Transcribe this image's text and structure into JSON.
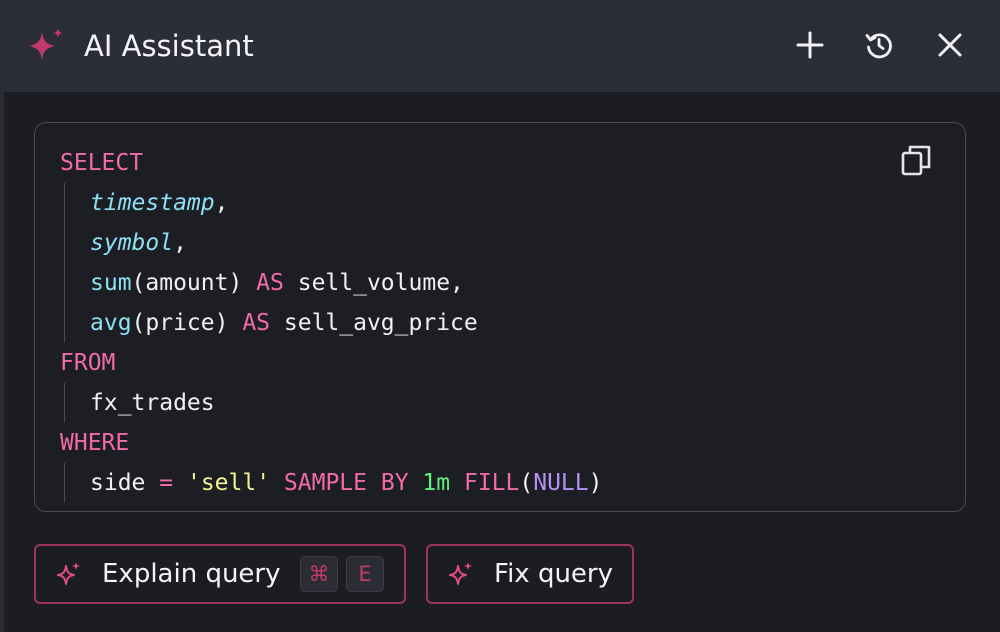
{
  "header": {
    "title": "AI Assistant",
    "logo_icon": "sparkle-icon",
    "actions": [
      {
        "name": "new-chat-button",
        "icon": "plus-icon"
      },
      {
        "name": "history-button",
        "icon": "history-icon"
      },
      {
        "name": "close-button",
        "icon": "close-icon"
      }
    ]
  },
  "code": {
    "copy_icon": "copy-icon",
    "lines": [
      [
        {
          "t": "SELECT",
          "c": "kw"
        }
      ],
      [
        {
          "t": "timestamp",
          "c": "col"
        },
        {
          "t": ",",
          "c": "plain"
        }
      ],
      [
        {
          "t": "symbol",
          "c": "col"
        },
        {
          "t": ",",
          "c": "plain"
        }
      ],
      [
        {
          "t": "sum",
          "c": "fn"
        },
        {
          "t": "(amount) ",
          "c": "plain"
        },
        {
          "t": "AS",
          "c": "kw"
        },
        {
          "t": " sell_volume,",
          "c": "plain"
        }
      ],
      [
        {
          "t": "avg",
          "c": "fn"
        },
        {
          "t": "(price) ",
          "c": "plain"
        },
        {
          "t": "AS",
          "c": "kw"
        },
        {
          "t": " sell_avg_price",
          "c": "plain"
        }
      ],
      [
        {
          "t": "FROM",
          "c": "kw"
        }
      ],
      [
        {
          "t": "fx_trades",
          "c": "plain"
        }
      ],
      [
        {
          "t": "WHERE",
          "c": "kw"
        }
      ],
      [
        {
          "t": "side ",
          "c": "plain"
        },
        {
          "t": "=",
          "c": "kw"
        },
        {
          "t": " ",
          "c": "plain"
        },
        {
          "t": "'sell'",
          "c": "str"
        },
        {
          "t": " ",
          "c": "plain"
        },
        {
          "t": "SAMPLE BY",
          "c": "kw"
        },
        {
          "t": " ",
          "c": "plain"
        },
        {
          "t": "1m",
          "c": "num"
        },
        {
          "t": " ",
          "c": "plain"
        },
        {
          "t": "FILL",
          "c": "kw"
        },
        {
          "t": "(",
          "c": "plain"
        },
        {
          "t": "NULL",
          "c": "nul"
        },
        {
          "t": ")",
          "c": "plain"
        }
      ]
    ]
  },
  "actions": {
    "explain_label": "Explain query",
    "explain_shortcut": [
      "⌘",
      "E"
    ],
    "fix_label": "Fix query"
  },
  "colors": {
    "accent": "#c23a6b",
    "keyword": "#f06ba8",
    "function": "#8ee0f5",
    "string": "#f3f38f",
    "number": "#5ef07a",
    "null": "#b691f5"
  }
}
